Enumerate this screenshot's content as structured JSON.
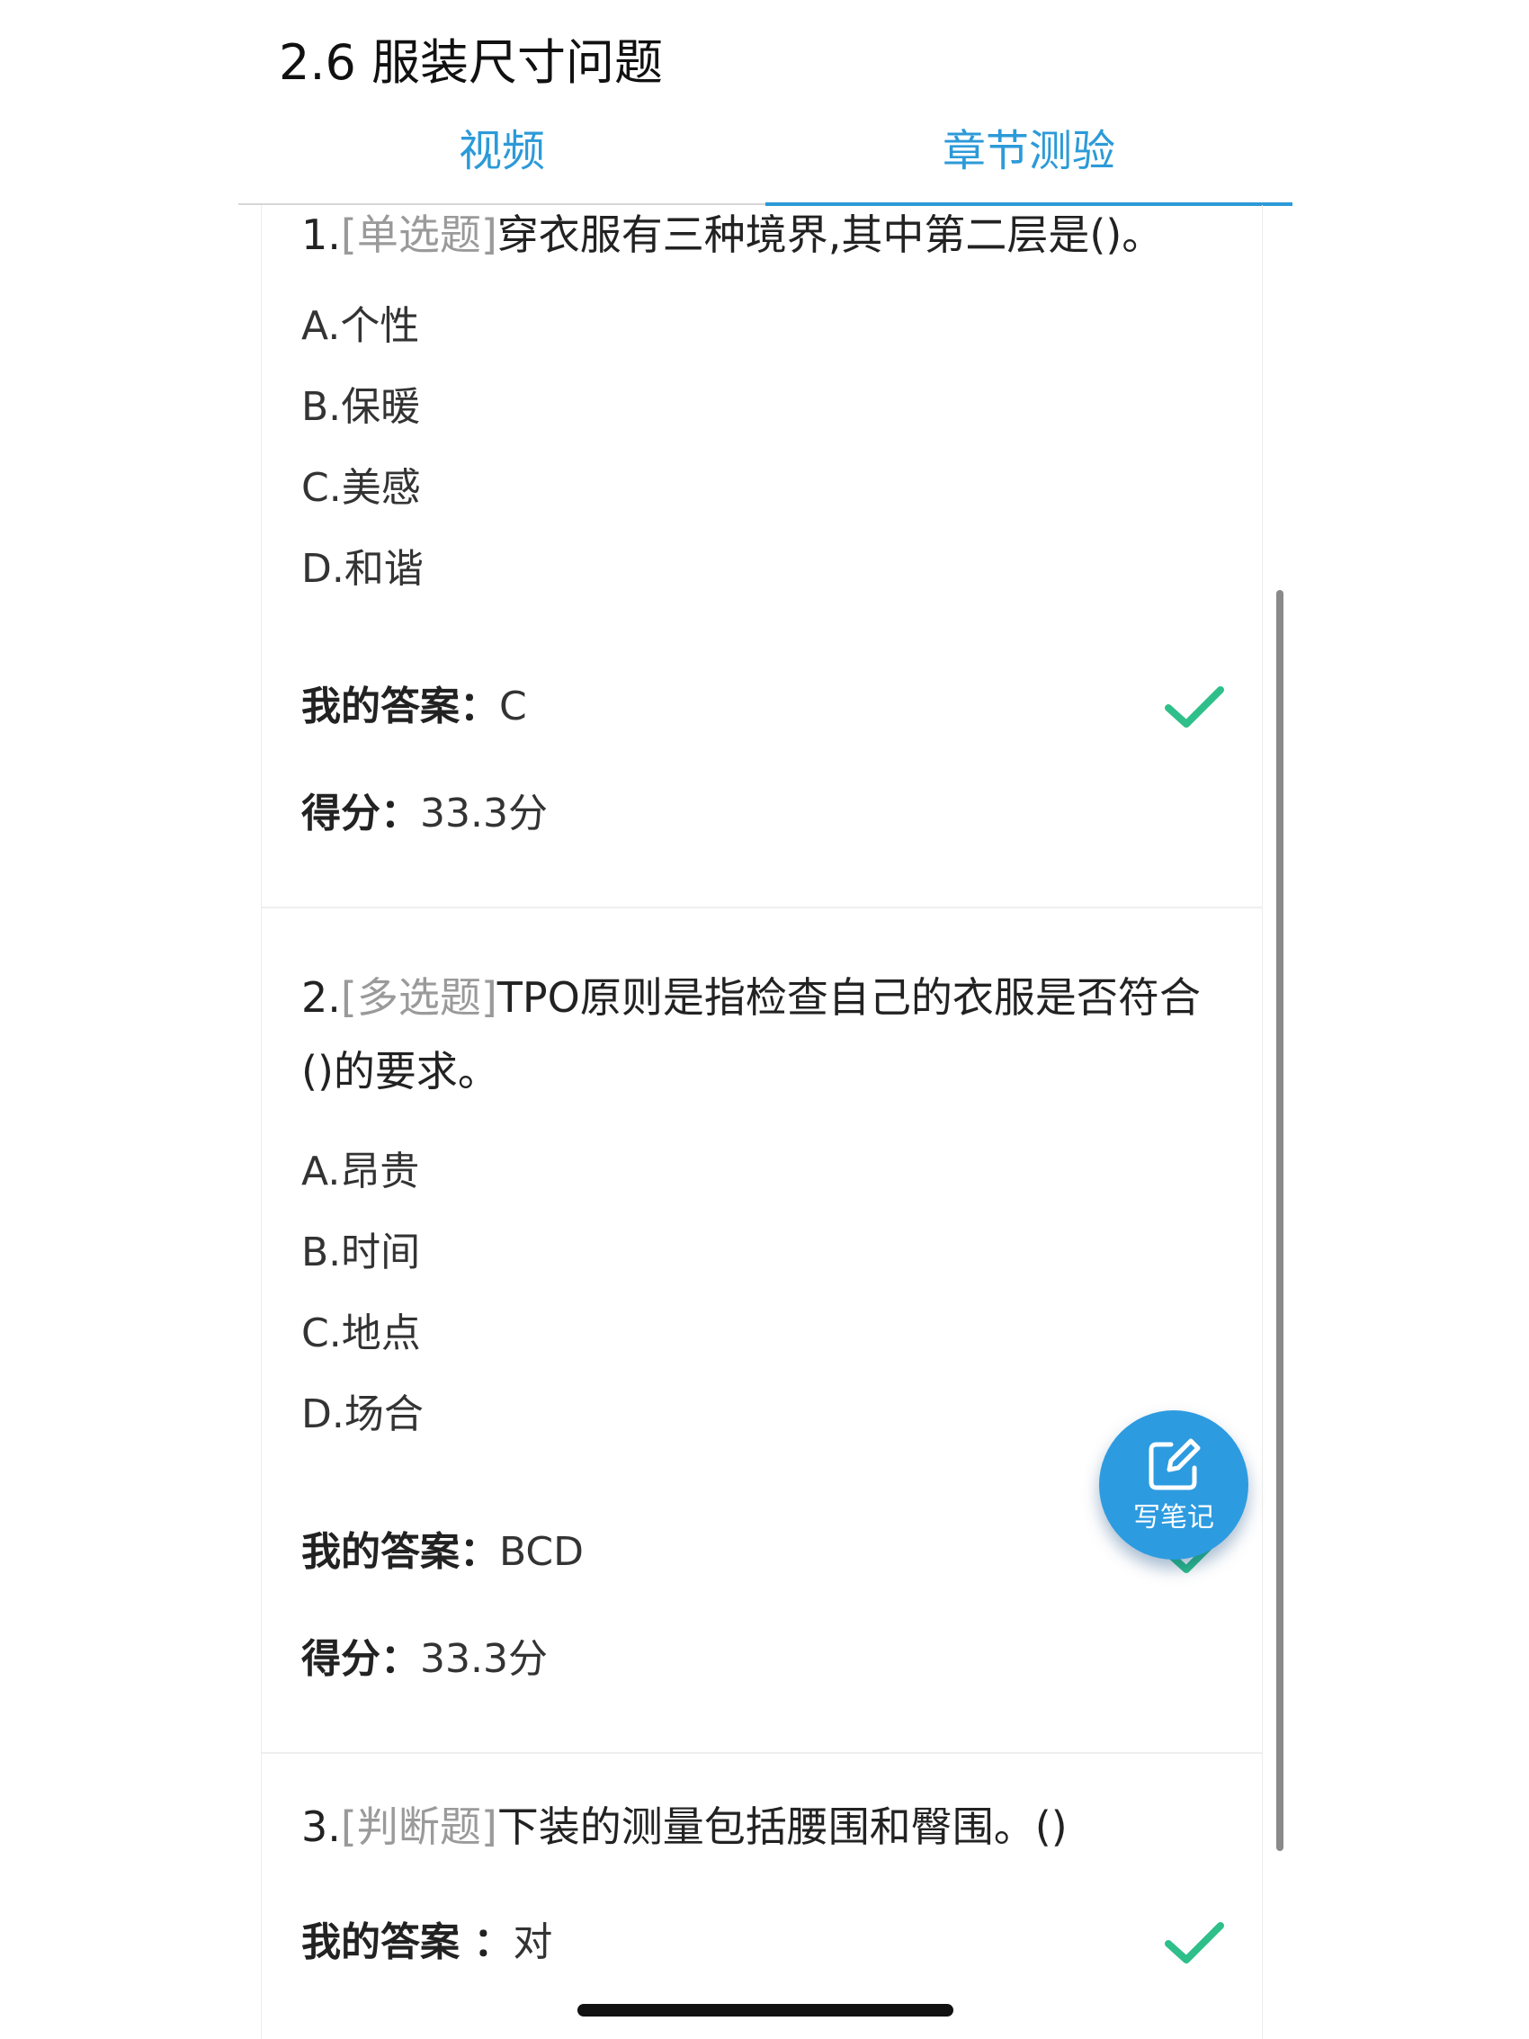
{
  "header": {
    "title": "2.6 服装尺寸问题"
  },
  "tabs": [
    {
      "label": "视频",
      "active": false
    },
    {
      "label": "章节测验",
      "active": true
    }
  ],
  "questions": [
    {
      "number": "1.",
      "type": "[单选题]",
      "stem": "穿衣服有三种境界,其中第二层是()。",
      "options": [
        "A.个性",
        "B.保暖",
        "C.美感",
        "D.和谐"
      ],
      "answer_label": "我的答案：",
      "answer": "C",
      "score_label": "得分：",
      "score": "33.3分",
      "correct": true
    },
    {
      "number": "2.",
      "type": "[多选题]",
      "stem": "TPO原则是指检查自己的衣服是否符合()的要求。",
      "options": [
        "A.昂贵",
        "B.时间",
        "C.地点",
        "D.场合"
      ],
      "answer_label": "我的答案：",
      "answer": "BCD",
      "score_label": "得分：",
      "score": "33.3分",
      "correct": true
    },
    {
      "number": "3.",
      "type": "[判断题]",
      "stem": "下装的测量包括腰围和臀围。()",
      "options": [],
      "answer_label": "我的答案 ：",
      "answer": "对",
      "correct": true
    }
  ],
  "note_button": {
    "label": "写笔记",
    "icon": "edit-note-icon"
  },
  "colors": {
    "accent": "#2c9ad8",
    "check": "#2fbf8a",
    "fab": "#2d9be0"
  }
}
